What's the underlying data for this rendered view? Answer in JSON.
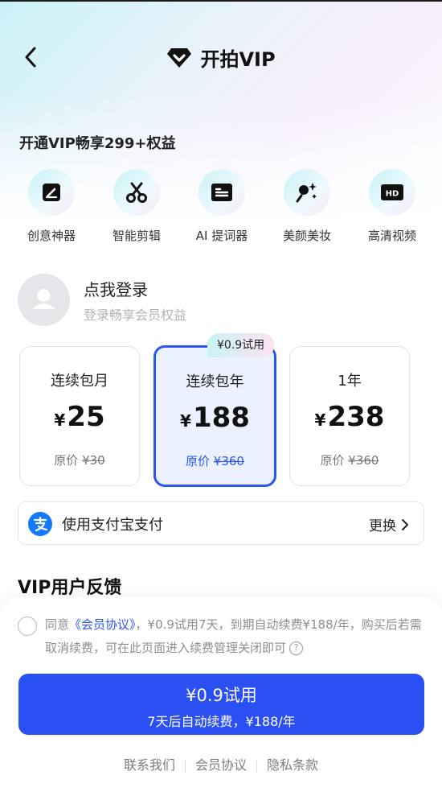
{
  "nav": {
    "title": "开拍VIP"
  },
  "hero": {
    "subtitle": "开通VIP畅享299+权益"
  },
  "features": [
    {
      "label": "创意神器",
      "icon": "magic-pen-icon"
    },
    {
      "label": "智能剪辑",
      "icon": "scissors-icon"
    },
    {
      "label": "AI 提词器",
      "icon": "teleprompter-icon"
    },
    {
      "label": "美颜美妆",
      "icon": "beauty-wand-icon"
    },
    {
      "label": "高清视频",
      "icon": "hd-icon"
    }
  ],
  "login": {
    "title": "点我登录",
    "subtitle": "登录畅享会员权益"
  },
  "plans": [
    {
      "name": "连续包月",
      "currency": "¥",
      "price": "25",
      "orig_label": "原价",
      "orig_price": "¥30"
    },
    {
      "name": "连续包年",
      "currency": "¥",
      "price": "188",
      "orig_label": "原价",
      "orig_price": "¥360"
    },
    {
      "name": "1年",
      "currency": "¥",
      "price": "238",
      "orig_label": "原价",
      "orig_price": "¥360"
    }
  ],
  "badge": "¥0.9试用",
  "payment": {
    "label": "使用支付宝支付",
    "change": "更换"
  },
  "feedback": {
    "title": "VIP用户反馈"
  },
  "agreement": {
    "prefix": "同意",
    "link": "《会员协议》",
    "text": "，¥0.9试用7天，到期自动续费¥188/年，购买后若需取消续费，可在此页面进入续费管理关闭即可"
  },
  "cta": {
    "line1": "¥0.9试用",
    "line2": "7天后自动续费，¥188/年"
  },
  "footer": {
    "contact": "联系我们",
    "agreement": "会员协议",
    "privacy": "隐私条款"
  },
  "colors": {
    "accent": "#2a4ff2",
    "alipay": "#1677ff"
  }
}
